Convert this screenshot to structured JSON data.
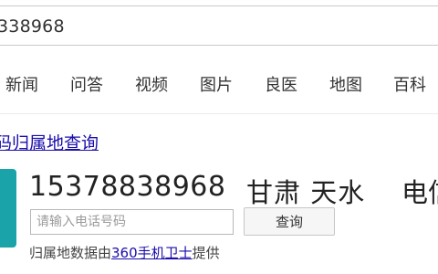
{
  "search": {
    "query": "338968"
  },
  "nav": {
    "tabs": [
      {
        "label": "新闻"
      },
      {
        "label": "问答"
      },
      {
        "label": "视频"
      },
      {
        "label": "图片"
      },
      {
        "label": "良医"
      },
      {
        "label": "地图"
      },
      {
        "label": "百科"
      }
    ]
  },
  "result": {
    "title": "码归属地查询",
    "phone_number": "15378838968",
    "location": "甘肃 天水",
    "carrier": "电信",
    "input_placeholder": "请输入电话号码",
    "query_button": "查询",
    "source_prefix": "归属地数据由",
    "source_link": "360手机卫士",
    "source_suffix": "提供"
  },
  "colors": {
    "link": "#1a0dab",
    "card_icon": "#1aa3a9"
  }
}
